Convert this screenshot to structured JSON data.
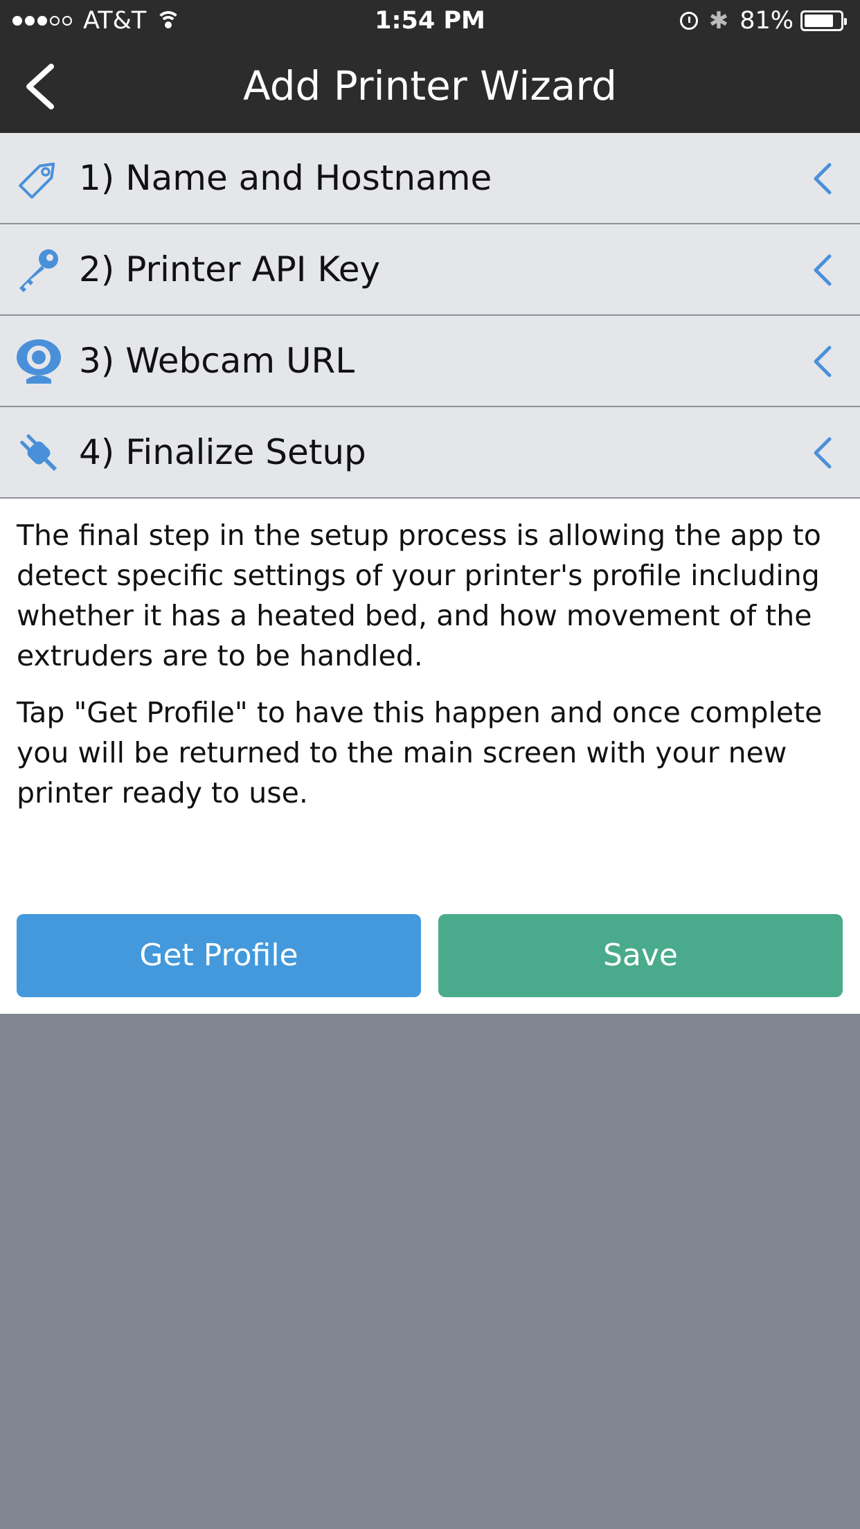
{
  "status_bar": {
    "carrier": "AT&T",
    "time": "1:54 PM",
    "battery_percent": "81%",
    "battery_level": 0.81,
    "signal_bars_filled": 3,
    "signal_bars_total": 5
  },
  "nav": {
    "title": "Add Printer Wizard",
    "back_icon": "chevron-left-icon"
  },
  "steps": [
    {
      "label": "1) Name and Hostname",
      "icon": "tag-icon"
    },
    {
      "label": "2) Printer API Key",
      "icon": "key-icon"
    },
    {
      "label": "3) Webcam URL",
      "icon": "webcam-icon"
    },
    {
      "label": "4) Finalize Setup",
      "icon": "plug-icon"
    }
  ],
  "content": {
    "paragraph_1": "The final step in the setup process is allowing the app to detect specific settings of your printer's profile including whether it has a heated bed, and how movement of the extruders are to be handled.",
    "paragraph_2": "Tap \"Get Profile\" to have this happen and once complete you will be returned to the main screen with your new printer ready to use."
  },
  "buttons": {
    "get_profile": "Get Profile",
    "save": "Save"
  },
  "colors": {
    "header_bg": "#2c2c2c",
    "step_bg": "#e5e6ea",
    "accent_icon": "#4a90d9",
    "get_profile_bg": "#4399db",
    "save_bg": "#4aab8c",
    "empty_area_bg": "#808790"
  }
}
